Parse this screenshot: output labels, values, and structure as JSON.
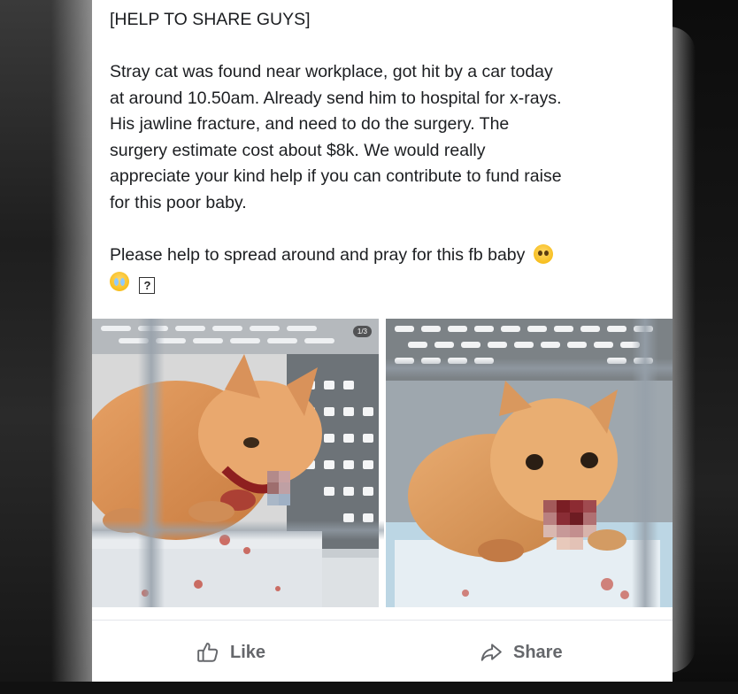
{
  "post": {
    "header": "[HELP TO SHARE GUYS]",
    "paragraph1_lines": [
      "Stray cat was found near workplace, got hit by a car today",
      "at around 10.50am. Already send him to hospital for x-rays.",
      "His jawline fracture, and need to do the surgery. The",
      "surgery estimate cost about $8k. We would really",
      "appreciate your kind help if you can contribute to fund raise",
      "for this poor baby."
    ],
    "paragraph2": "Please help to spread around and pray for this fb baby",
    "emoji_names": [
      "pleading-face-emoji",
      "crying-face-emoji"
    ],
    "unknown_glyph": "?"
  },
  "photos": [
    {
      "name": "injured-cat-photo-1",
      "badge": "1/3"
    },
    {
      "name": "injured-cat-photo-2"
    }
  ],
  "actions": {
    "like_label": "Like",
    "share_label": "Share",
    "like_icon": "thumbs-up-icon",
    "share_icon": "share-arrow-icon"
  },
  "colors": {
    "card_background": "#ffffff",
    "text": "#1c1e21",
    "action_text": "#65676b"
  }
}
